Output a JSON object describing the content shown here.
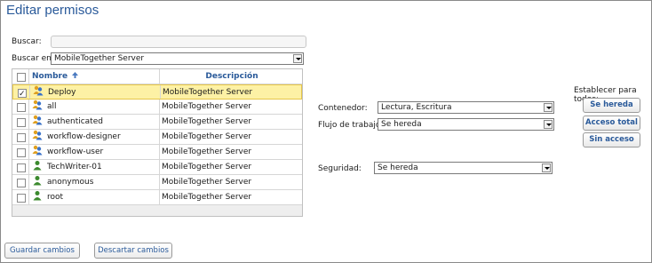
{
  "page": {
    "title": "Editar permisos"
  },
  "search": {
    "label": "Buscar:",
    "value": ""
  },
  "search_in": {
    "label": "Buscar en:",
    "value": "MobileTogether Server"
  },
  "table": {
    "headers": {
      "name": "Nombre",
      "description": "Descripción"
    },
    "rows": [
      {
        "name": "Deploy",
        "description": "MobileTogether Server",
        "checked": true,
        "icon": "group-icon",
        "selected": true
      },
      {
        "name": "all",
        "description": "MobileTogether Server",
        "checked": false,
        "icon": "group-icon",
        "selected": false
      },
      {
        "name": "authenticated",
        "description": "MobileTogether Server",
        "checked": false,
        "icon": "group-icon",
        "selected": false
      },
      {
        "name": "workflow-designer",
        "description": "MobileTogether Server",
        "checked": false,
        "icon": "group-icon",
        "selected": false
      },
      {
        "name": "workflow-user",
        "description": "MobileTogether Server",
        "checked": false,
        "icon": "group-icon",
        "selected": false
      },
      {
        "name": "TechWriter-01",
        "description": "MobileTogether Server",
        "checked": false,
        "icon": "user-icon",
        "selected": false
      },
      {
        "name": "anonymous",
        "description": "MobileTogether Server",
        "checked": false,
        "icon": "user-icon",
        "selected": false
      },
      {
        "name": "root",
        "description": "MobileTogether Server",
        "checked": false,
        "icon": "user-icon",
        "selected": false
      }
    ]
  },
  "permissions": {
    "container": {
      "label": "Contenedor:",
      "value": "Lectura, Escritura"
    },
    "workflow": {
      "label": "Flujo de trabajo:",
      "value": "Se hereda"
    },
    "security": {
      "label": "Seguridad:",
      "value": "Se hereda"
    }
  },
  "set_all": {
    "label": "Establecer para todos:",
    "inherit": "Se hereda",
    "full_access": "Acceso total",
    "no_access": "Sin acceso"
  },
  "footer": {
    "save": "Guardar cambios",
    "discard": "Descartar cambios"
  },
  "colors": {
    "accent": "#2a5a9a",
    "selected_row": "#fdf1a5",
    "user_icon": "#3c8a2e",
    "group_icon": "#e0a020"
  }
}
